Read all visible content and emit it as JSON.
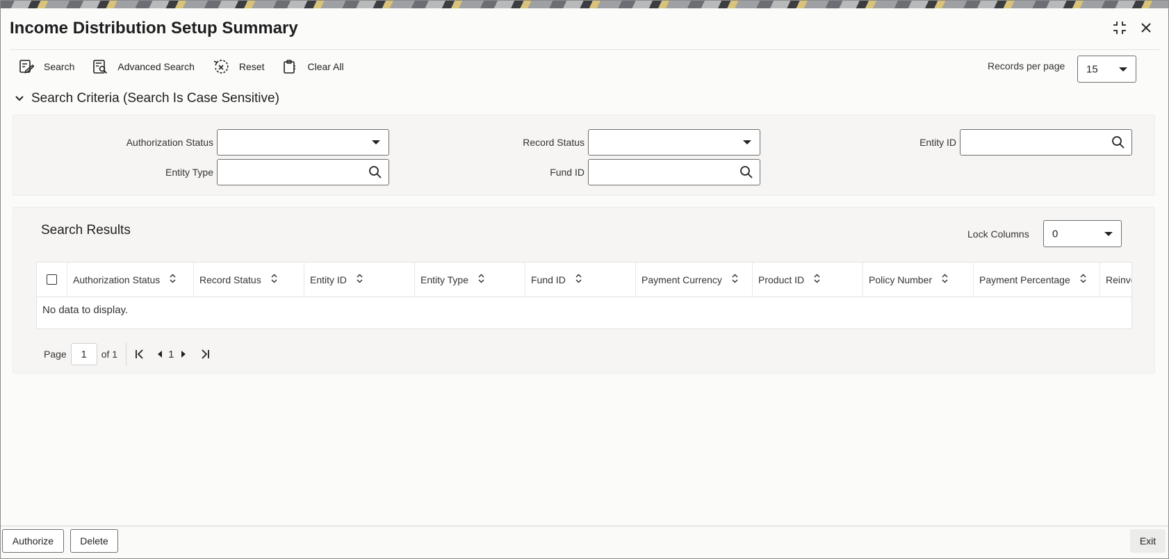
{
  "window": {
    "title": "Income Distribution Setup Summary"
  },
  "toolbar": {
    "search": "Search",
    "advanced_search": "Advanced Search",
    "reset": "Reset",
    "clear_all": "Clear All",
    "records_per_page_label": "Records per page",
    "records_per_page_value": "15"
  },
  "criteria": {
    "title": "Search Criteria (Search Is Case Sensitive)",
    "authorization_status_label": "Authorization Status",
    "authorization_status_value": "",
    "record_status_label": "Record Status",
    "record_status_value": "",
    "entity_id_label": "Entity ID",
    "entity_type_label": "Entity Type",
    "fund_id_label": "Fund ID"
  },
  "results": {
    "title": "Search Results",
    "lock_columns_label": "Lock Columns",
    "lock_columns_value": "0",
    "columns": [
      "Authorization Status",
      "Record Status",
      "Entity ID",
      "Entity Type",
      "Fund ID",
      "Payment Currency",
      "Product ID",
      "Policy Number",
      "Payment Percentage",
      "Reinve"
    ],
    "empty_message": "No data to display."
  },
  "pager": {
    "page_label": "Page",
    "current_page": "1",
    "of_label": "of 1",
    "nav_page": "1"
  },
  "footer": {
    "authorize": "Authorize",
    "delete": "Delete",
    "exit": "Exit"
  }
}
